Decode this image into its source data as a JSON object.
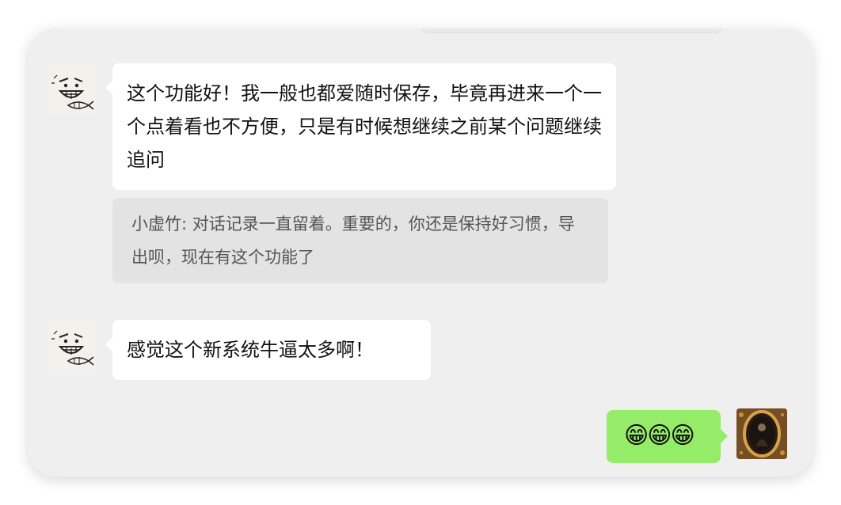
{
  "messages": [
    {
      "sender": "other",
      "text": "这个功能好！我一般也都爱随时保存，毕竟再进来一个一个点着看也不方便，只是有时候想继续之前某个问题继续追问",
      "quote": "小虚竹: 对话记录一直留着。重要的，你还是保持好习惯，导出呗，现在有这个功能了"
    },
    {
      "sender": "other",
      "text": "感觉这个新系统牛逼太多啊！"
    },
    {
      "sender": "self",
      "text": "😁😁😁"
    }
  ]
}
